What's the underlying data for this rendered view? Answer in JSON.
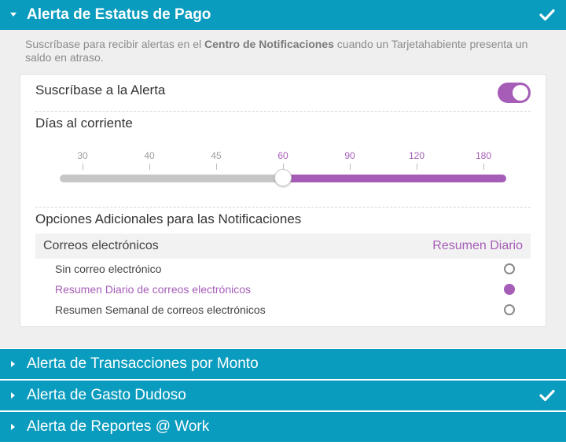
{
  "panels": [
    {
      "title": "Alerta de Estatus de Pago",
      "expanded": true,
      "checked": true
    },
    {
      "title": "Alerta de Transacciones por Monto",
      "expanded": false,
      "checked": false
    },
    {
      "title": "Alerta de Gasto Dudoso",
      "expanded": false,
      "checked": true
    },
    {
      "title": "Alerta de Reportes @ Work",
      "expanded": false,
      "checked": false
    }
  ],
  "description": {
    "before": "Suscríbase para recibir alertas en el ",
    "bold": "Centro de Notificaciones",
    "after": " cuando un Tarjetahabiente presenta un saldo en atraso."
  },
  "subscribe": {
    "label": "Suscríbase a la Alerta",
    "enabled": true
  },
  "days": {
    "label": "Días al corriente",
    "ticks": [
      "30",
      "40",
      "45",
      "60",
      "90",
      "120",
      "180"
    ],
    "selected": "60"
  },
  "options": {
    "label": "Opciones Adicionales para las Notificaciones",
    "header_left": "Correos electrónicos",
    "header_right": "Resumen Diario",
    "items": [
      {
        "label": "Sin correo electrónico",
        "selected": false
      },
      {
        "label": "Resumen Diario de correos electrónicos",
        "selected": true
      },
      {
        "label": "Resumen Semanal de correos electrónicos",
        "selected": false
      }
    ]
  },
  "colors": {
    "header": "#0a9cbe",
    "accent": "#a55db7"
  },
  "icons": {
    "expand": "caret-down-icon",
    "collapse": "caret-right-icon",
    "done": "checkmark-icon"
  }
}
